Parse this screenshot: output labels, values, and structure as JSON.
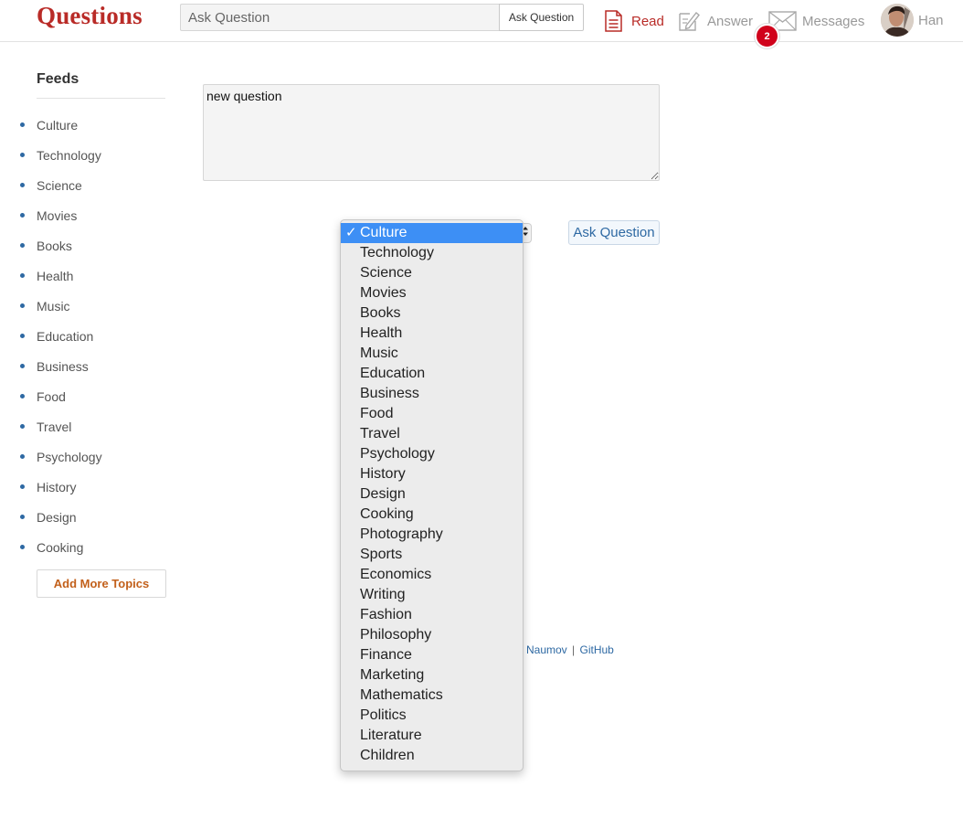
{
  "header": {
    "logo": "Questions",
    "search_placeholder": "Ask Question",
    "search_button": "Ask Question",
    "nav": {
      "read": "Read",
      "answer": "Answer",
      "messages": "Messages",
      "messages_badge": "2",
      "profile_name": "Han"
    }
  },
  "sidebar": {
    "title": "Feeds",
    "topics": [
      "Culture",
      "Technology",
      "Science",
      "Movies",
      "Books",
      "Health",
      "Music",
      "Education",
      "Business",
      "Food",
      "Travel",
      "Psychology",
      "History",
      "Design",
      "Cooking"
    ],
    "add_button": "Add More Topics"
  },
  "main": {
    "question_text": "new question",
    "submit_button": "Ask Question",
    "topic_select": {
      "selected": "Culture",
      "check_mark": "✓",
      "options": [
        "Culture",
        "Technology",
        "Science",
        "Movies",
        "Books",
        "Health",
        "Music",
        "Education",
        "Business",
        "Food",
        "Travel",
        "Psychology",
        "History",
        "Design",
        "Cooking",
        "Photography",
        "Sports",
        "Economics",
        "Writing",
        "Fashion",
        "Philosophy",
        "Finance",
        "Marketing",
        "Mathematics",
        "Politics",
        "Literature",
        "Children"
      ]
    },
    "footer": {
      "author_link": "Naumov",
      "separator": "|",
      "github_link": "GitHub"
    }
  },
  "colors": {
    "brand": "#b92b27",
    "link": "#2e69a3",
    "accent_orange": "#c2601b",
    "badge": "#d0021b",
    "select_highlight": "#3d8ff5"
  }
}
